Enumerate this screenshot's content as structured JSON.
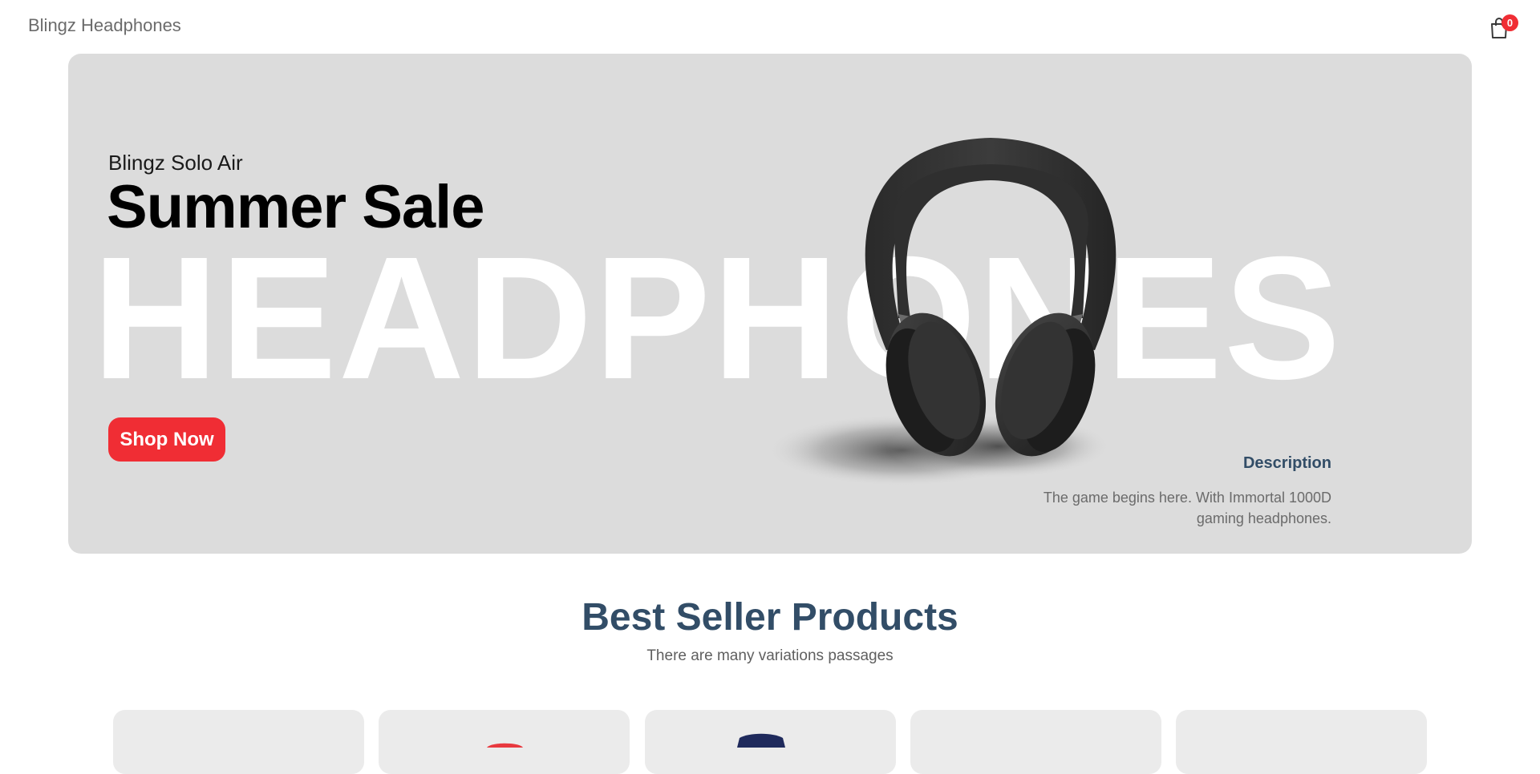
{
  "navbar": {
    "logo": "Blingz Headphones",
    "cart_count": "0",
    "cart_icon": "shopping-bag-icon"
  },
  "hero": {
    "small_text": "Blingz Solo Air",
    "mid_text": "Summer Sale",
    "large_text": "HEADPHONES",
    "button_label": "Shop Now",
    "description_title": "Description",
    "description_text": "The game begins here. With Immortal 1000D gaming headphones.",
    "image": "headphones-image",
    "background_color": "#dcdcdc",
    "accent_color": "#f02d34"
  },
  "best_sellers": {
    "title": "Best Seller Products",
    "subtitle": "There are many variations passages",
    "products": [
      {
        "image": "product-image-1"
      },
      {
        "image": "red-speaker-image"
      },
      {
        "image": "blue-headphones-image"
      },
      {
        "image": "product-image-4"
      },
      {
        "image": "product-image-5"
      }
    ]
  },
  "colors": {
    "brand": "#f02d34",
    "heading": "#324d67",
    "card": "#ebebeb"
  }
}
